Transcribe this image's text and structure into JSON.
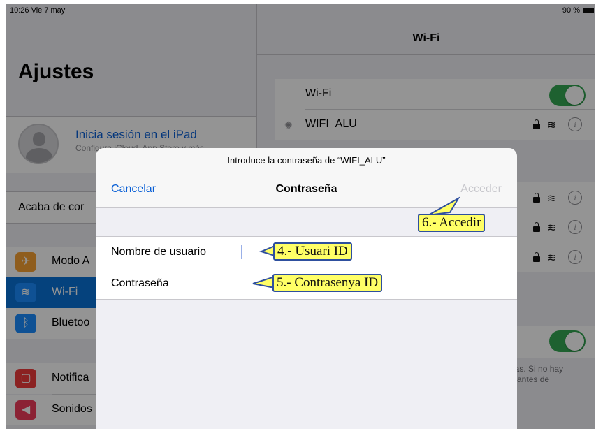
{
  "status_bar": {
    "time": "10:26  Vie 7 may",
    "battery": "90 %"
  },
  "settings": {
    "title": "Ajustes",
    "account": {
      "title": "Inicia sesión en el iPad",
      "subtitle": "Configura iCloud, App Store y más"
    },
    "recent_label": "Acaba de cor",
    "items": [
      {
        "label": "Modo A",
        "icon": "airplane-icon",
        "color": "#f7a033"
      },
      {
        "label": "Wi-Fi",
        "icon": "wifi-icon",
        "color": "#1a8cff",
        "selected": true
      },
      {
        "label": "Bluetoo",
        "icon": "bluetooth-icon",
        "color": "#1a8cff"
      },
      {
        "label": "Notifica",
        "icon": "notifications-icon",
        "color": "#f03c3c"
      },
      {
        "label": "Sonidos",
        "icon": "sounds-icon",
        "color": "#f03c5a"
      }
    ]
  },
  "wifi": {
    "nav_title": "Wi-Fi",
    "wifi_label": "Wi-Fi",
    "network": "WIFI_ALU",
    "footnote_line1": "das. Si no hay",
    "footnote_line2": "á antes de",
    "accent": "#34a853"
  },
  "modal": {
    "prompt": "Introduce la contraseña de “WIFI_ALU”",
    "cancel": "Cancelar",
    "title": "Contraseña",
    "join": "Acceder",
    "username_label": "Nombre de usuario",
    "password_label": "Contraseña",
    "username_value": "",
    "password_value": ""
  },
  "annotations": {
    "accedir": "6.- Accedir",
    "usuari": "4.- Usuari ID",
    "contrasenya": "5.- Contrasenya ID"
  }
}
